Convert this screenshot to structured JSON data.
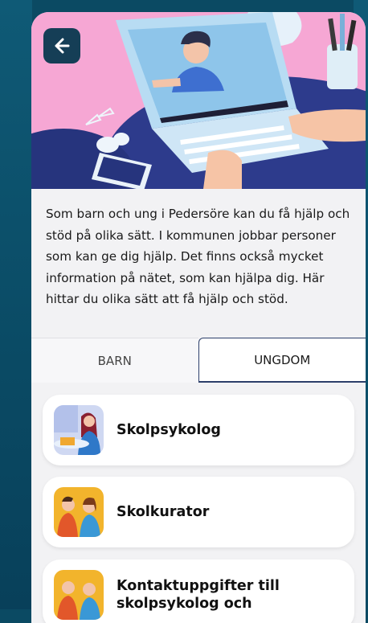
{
  "header": {
    "back_icon": "arrow-left-icon"
  },
  "colors": {
    "accent": "#153e56",
    "hero_background": "#f6a7d4",
    "tab_active_border": "#2c3f6a",
    "page_background": "#0b4a63"
  },
  "intro": {
    "text": "Som barn och ung i Pedersöre kan du få hjälp och stöd på olika sätt. I kommunen jobbar personer som kan ge dig hjälp. Det finns också mycket information på nätet, som kan hjälpa dig. Här hittar du olika sätt att få hjälp och stöd."
  },
  "tabs": [
    {
      "label": "BARN",
      "active": false
    },
    {
      "label": "UNGDOM",
      "active": true
    }
  ],
  "items": [
    {
      "label": "Skolpsykolog",
      "icon": "psychologist-icon"
    },
    {
      "label": "Skolkurator",
      "icon": "counselor-icon"
    },
    {
      "label": "Kontaktuppgifter till skolpsykolog och",
      "icon": "contact-icon"
    }
  ]
}
